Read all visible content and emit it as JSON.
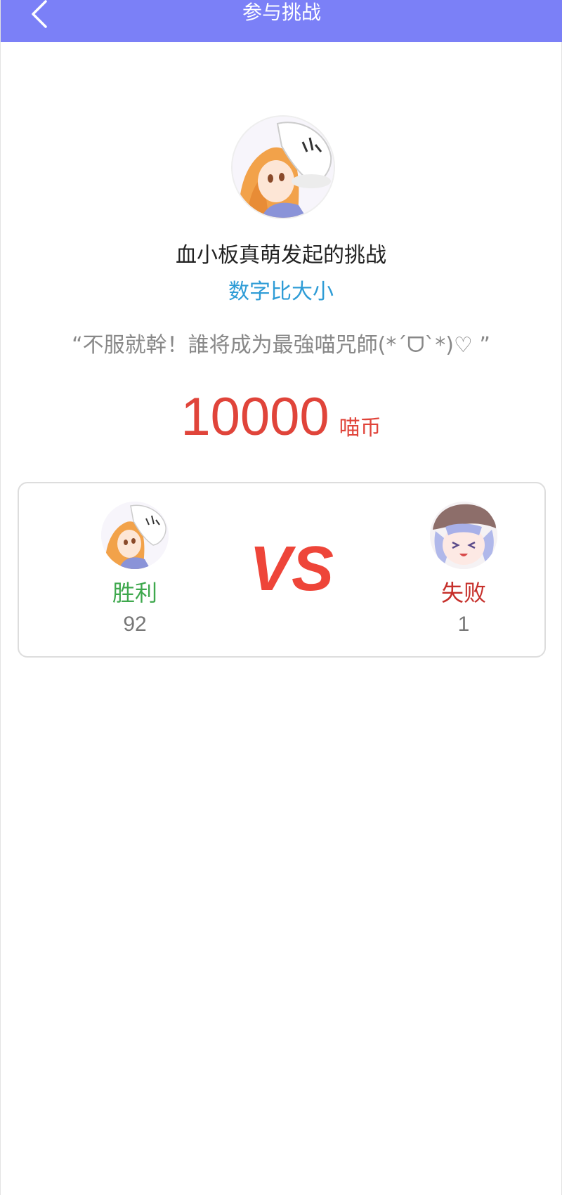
{
  "header": {
    "title": "参与挑战",
    "back_icon": "chevron-left-icon",
    "background": "#7b80f7"
  },
  "challenge": {
    "title": "血小板真萌发起的挑战",
    "game_name": "数字比大小",
    "slogan": "“不服就幹！誰将成为最強喵咒師(*ˊᗜˋ*)♡ ”",
    "reward_amount": "10000",
    "reward_unit": "喵币"
  },
  "vs": {
    "left_player": {
      "result": "胜利",
      "score": "92"
    },
    "right_player": {
      "result": "失败",
      "score": "1"
    },
    "vs_text": "VS"
  },
  "colors": {
    "accent": "#7b80f7",
    "game_name": "#2e9cd6",
    "reward": "#e0443a",
    "win": "#3ea84d",
    "lose": "#c62f2a"
  }
}
